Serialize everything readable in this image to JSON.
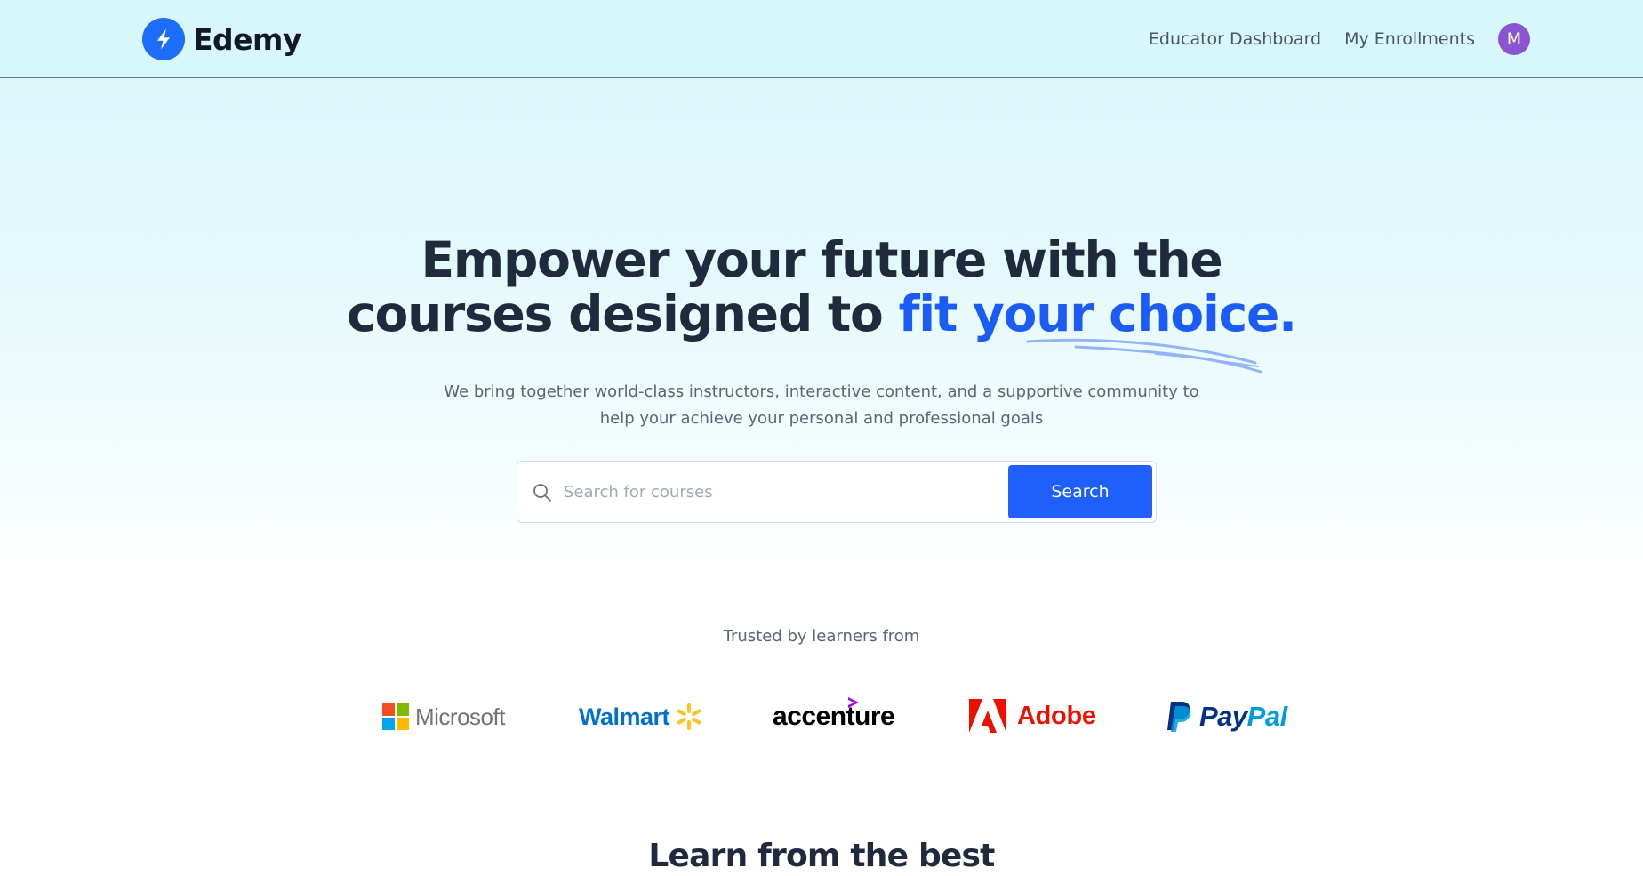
{
  "navbar": {
    "brand": "Edemy",
    "links": [
      "Educator Dashboard",
      "My Enrollments"
    ],
    "avatar_initial": "M"
  },
  "hero": {
    "title_line1": "Empower your future with the",
    "title_line2_plain": "courses designed to ",
    "title_line2_accent": "fit your choice.",
    "subtitle_line1": "We bring together world-class instructors, interactive content, and a supportive community to",
    "subtitle_line2": "help your achieve your personal and professional goals"
  },
  "search": {
    "placeholder": "Search for courses",
    "value": "",
    "button_label": "Search"
  },
  "trusted": {
    "label": "Trusted by learners from",
    "companies": [
      "Microsoft",
      "Walmart",
      "accenture",
      "Adobe",
      "PayPal"
    ]
  },
  "next_section": {
    "title": "Learn from the best"
  },
  "colors": {
    "brand_blue": "#1d6dfb",
    "accent_blue": "#1a5cf5",
    "button_blue": "#1f5ffb",
    "avatar_purple": "#8b54d1",
    "hero_bg": "#d8f7fb"
  },
  "icons": {
    "logo": "lightning-bolt-icon",
    "search": "search-icon"
  }
}
